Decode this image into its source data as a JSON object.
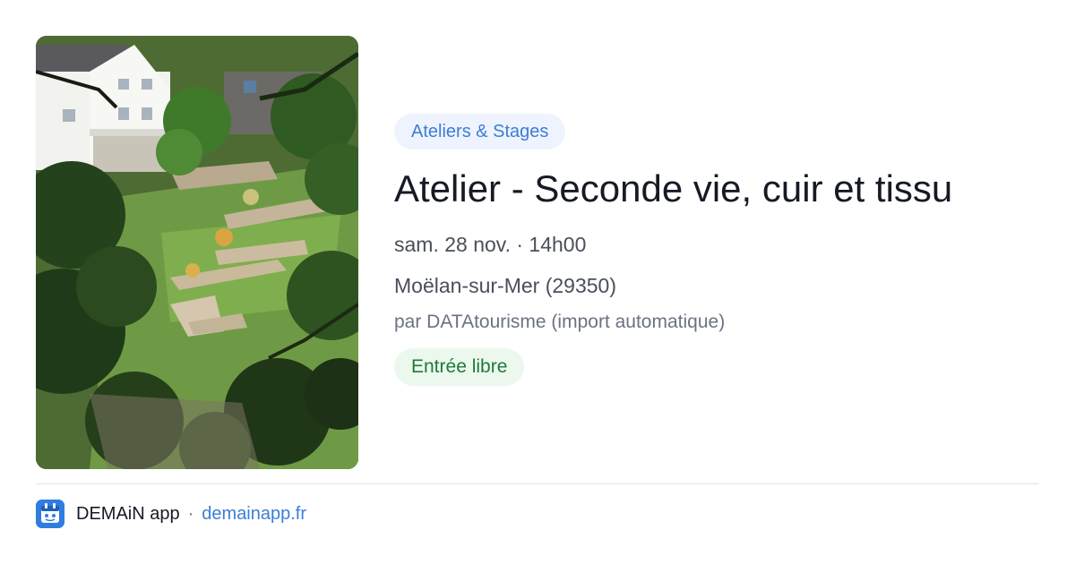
{
  "event": {
    "category": "Ateliers & Stages",
    "title": "Atelier - Seconde vie, cuir et tissu",
    "datetime": "sam. 28 nov. · 14h00",
    "location": "Moëlan-sur-Mer (29350)",
    "organizer": "par DATAtourisme (import automatique)",
    "price": "Entrée libre"
  },
  "footer": {
    "app_name": "DEMAiN app",
    "separator": "·",
    "domain": "demainapp.fr",
    "icon": "demain-app-logo-icon"
  },
  "colors": {
    "category_badge_bg": "#eef3fd",
    "category_badge_text": "#3b7ed6",
    "price_badge_bg": "#ecf8ee",
    "price_badge_text": "#1f7a3a",
    "link": "#3b7ed6",
    "app_icon": "#2f7de1"
  }
}
